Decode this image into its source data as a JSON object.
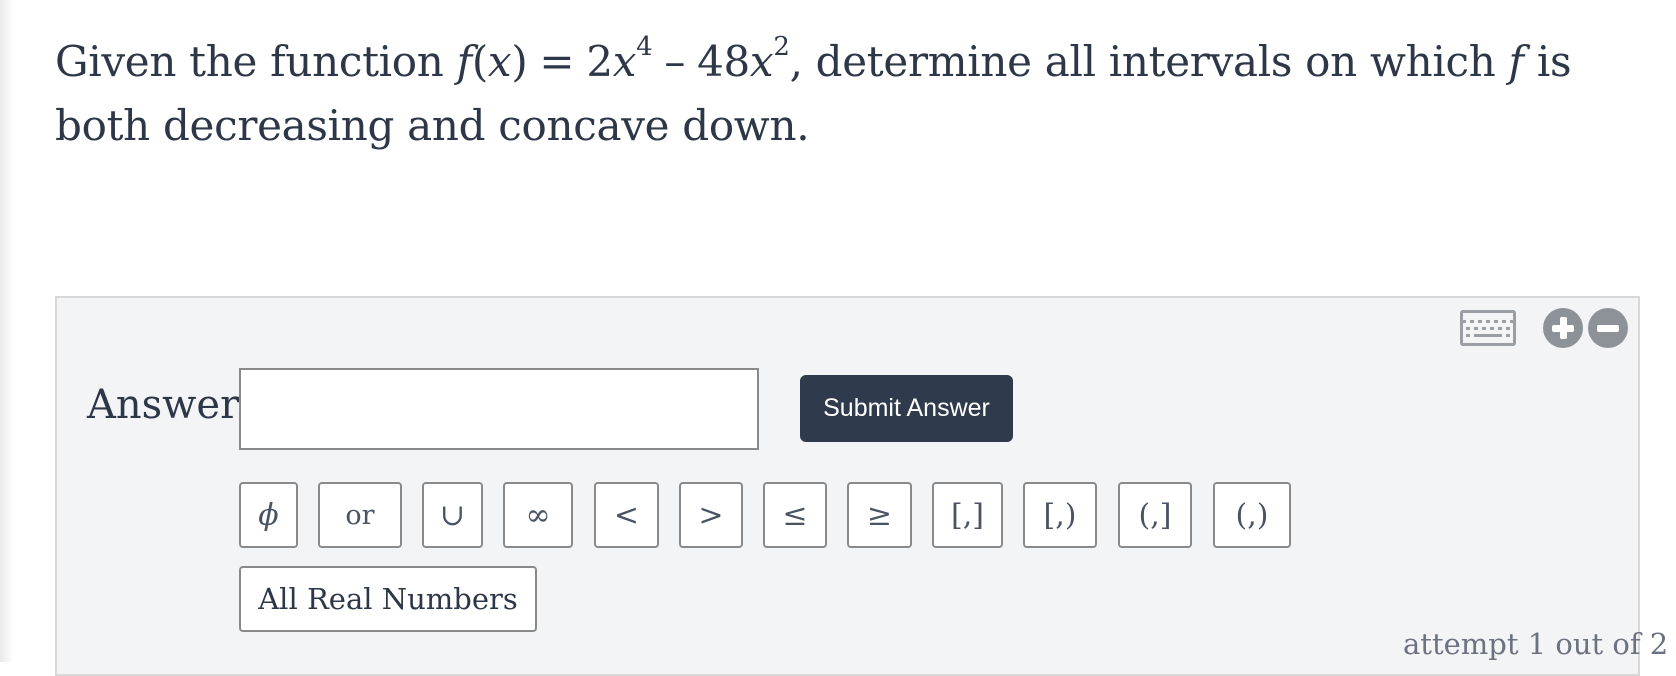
{
  "question": {
    "prefix": "Given the function",
    "fn_name": "f",
    "fn_open": "(",
    "fn_var": "x",
    "fn_close": ")",
    "equals": "=",
    "coef1": "2",
    "var1": "x",
    "exp1": "4",
    "minus": "–",
    "coef2": "48",
    "var2": "x",
    "exp2": "2",
    "middle": ", determine all intervals on which",
    "fn_ref": "f",
    "suffix": "is both decreasing and concave down."
  },
  "answer": {
    "label": "Answer:",
    "input_value": "",
    "submit_label": "Submit Answer"
  },
  "toolbar": {
    "keyboard_icon": "keyboard-icon",
    "zoom_in_icon": "plus-circle-icon",
    "zoom_out_icon": "minus-circle-icon"
  },
  "symbols": {
    "empty_set": "ϕ",
    "or": "or",
    "union": "∪",
    "infinity": "∞",
    "less_than": "<",
    "greater_than": ">",
    "less_equal": "≤",
    "greater_equal": "≥",
    "closed_closed": "[,]",
    "closed_open": "[,)",
    "open_closed": "(,]",
    "open_open": "(,)",
    "all_real": "All Real Numbers"
  },
  "attempt": "attempt 1 out of 2",
  "colors": {
    "submit_bg": "#2f3a4c",
    "panel_bg": "#f3f4f6",
    "text": "#2d3748",
    "icon_gray": "#8d9299"
  }
}
